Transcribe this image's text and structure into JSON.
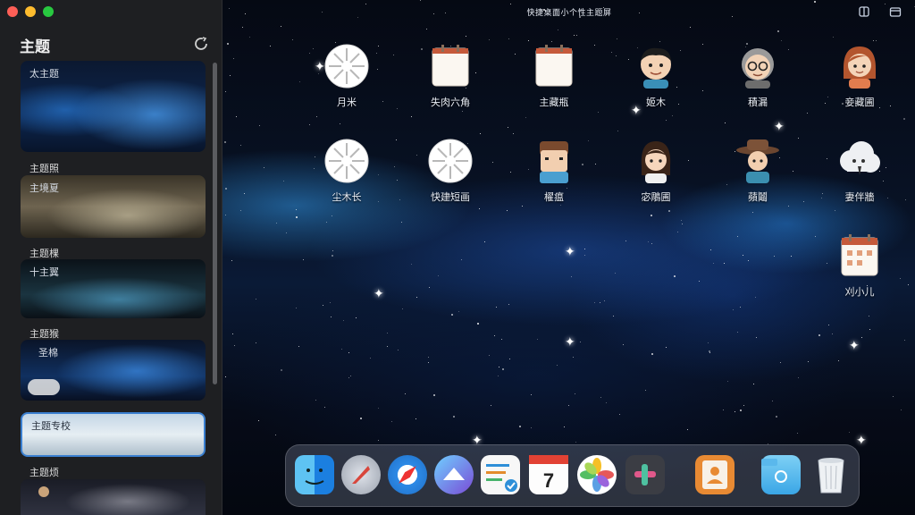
{
  "window": {
    "title": "快捷桌面小个性主题屏"
  },
  "sidebar": {
    "title": "主题",
    "themes": [
      {
        "label": "",
        "thumb_label": "太主题"
      },
      {
        "label": "主题照",
        "thumb_label": "主境夏"
      },
      {
        "label": "主题棵",
        "thumb_label": "十主翼"
      },
      {
        "label": "主题猴",
        "thumb_label": "圣棉"
      },
      {
        "label": "",
        "thumb_label": "主题专校"
      },
      {
        "label": "主题烦",
        "thumb_label": ""
      }
    ]
  },
  "desktop": {
    "icons": [
      {
        "label": "月米",
        "icon": "daisy-icon"
      },
      {
        "label": "失肉六角",
        "icon": "calendar-icon"
      },
      {
        "label": "主藏瓶",
        "icon": "calendar-icon"
      },
      {
        "label": "姬木",
        "icon": "boy-avatar-icon"
      },
      {
        "label": "積漏",
        "icon": "grandpa-avatar-icon"
      },
      {
        "label": "妾藏圃",
        "icon": "girl-avatar-icon"
      },
      {
        "label": "尘木长",
        "icon": "daisy-icon"
      },
      {
        "label": "快建短画",
        "icon": "daisy-icon"
      },
      {
        "label": "櫂瘟",
        "icon": "man-avatar-icon"
      },
      {
        "label": "宓鵰圃",
        "icon": "woman-avatar-icon"
      },
      {
        "label": "蘋鬮",
        "icon": "cowboy-avatar-icon"
      },
      {
        "label": "妻伴牆",
        "icon": "cloud-face-icon"
      },
      {
        "label": "刈小儿",
        "icon": "calendar-grid-icon"
      }
    ]
  },
  "dock": {
    "items": [
      "finder-icon",
      "launchpad-icon",
      "safari-icon",
      "mail-icon",
      "checklist-icon",
      "calendar-icon",
      "photos-icon",
      "slack-icon",
      "contacts-icon",
      "folder-icon",
      "trash-icon"
    ]
  },
  "colors": {
    "sidebar_bg": "#1e1f22",
    "accent_blue": "#2f7fd8"
  }
}
